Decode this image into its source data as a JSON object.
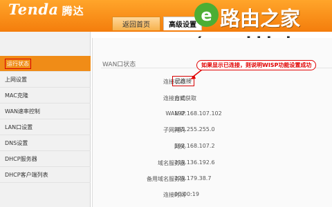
{
  "header": {
    "brand": "Tenda",
    "brand_cn": "腾达",
    "tabs": [
      {
        "label": "返回首页"
      },
      {
        "label": "高级设置"
      }
    ]
  },
  "watermark": {
    "circle_glyph": "e",
    "site_cn": "路由之家",
    "url": "(www.hhhyh.com)"
  },
  "sidebar": {
    "items": [
      {
        "label": "运行状态",
        "active": true
      },
      {
        "label": "上网设置"
      },
      {
        "label": "MAC克隆"
      },
      {
        "label": "WAN速率控制"
      },
      {
        "label": "LAN口设置"
      },
      {
        "label": "DNS设置"
      },
      {
        "label": "DHCP服务器"
      },
      {
        "label": "DHCP客户端列表"
      }
    ]
  },
  "main": {
    "section_title": "WAN口状态",
    "callout": "如果显示已连接，则说明WISP功能设置成功",
    "rows": [
      {
        "label": "连接状态",
        "value": "已连接"
      },
      {
        "label": "连接方式",
        "value": "自动获取"
      },
      {
        "label": "WAN IP",
        "value": "192.168.107.102"
      },
      {
        "label": "子网掩码",
        "value": "255.255.255.0"
      },
      {
        "label": "网关",
        "value": "192.168.107.2"
      },
      {
        "label": "域名服务器",
        "value": "211.136.192.6"
      },
      {
        "label": "备用域名服务器",
        "value": "221.179.38.7"
      },
      {
        "label": "连接时间",
        "value": "00:00:19"
      }
    ]
  },
  "colors": {
    "brand_orange": "#f47d0c",
    "active_item": "#f08c17",
    "highlight_red": "#d60000",
    "watermark_green": "#4cae34"
  }
}
